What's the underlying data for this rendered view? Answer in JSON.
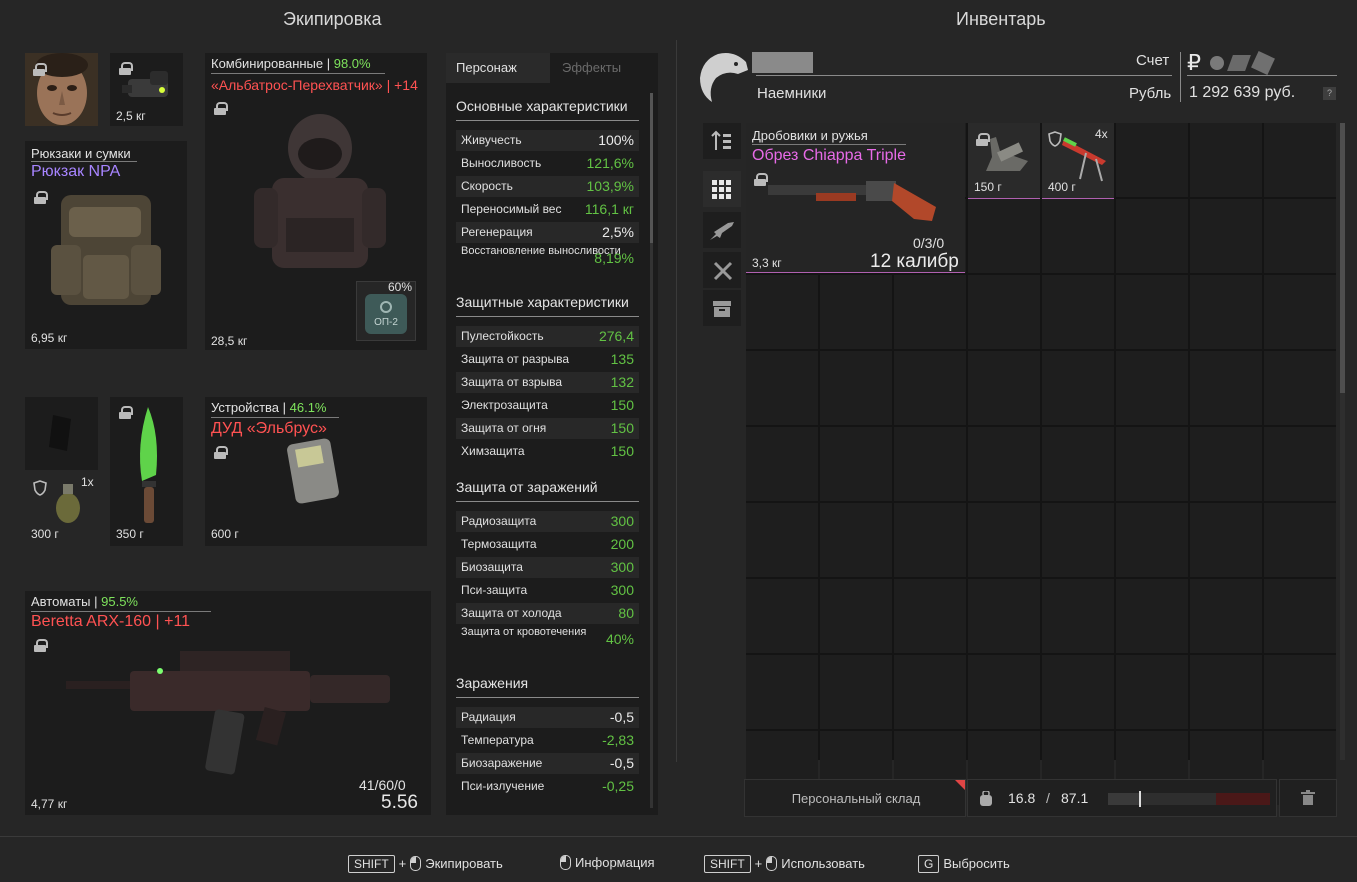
{
  "titles": {
    "equipment": "Экипировка",
    "inventory": "Инвентарь"
  },
  "colors": {
    "green": "#62c244",
    "pct_green": "#7ee35c",
    "red_item": "#ff5252",
    "purple_item": "#a784ff",
    "pink_item": "#e86be8"
  },
  "equip": {
    "head_icons": [
      "face-portrait",
      "night-vision-device"
    ],
    "nvd_weight": "2,5 кг",
    "backpack": {
      "category": "Рюкзаки и сумки",
      "name": "Рюкзак NPA",
      "weight": "6,95 кг"
    },
    "armor": {
      "category": "Комбинированные",
      "sep": " | ",
      "percent": "98.0%",
      "name": "«Альбатрос-Перехватчик» | +14",
      "weight": "28,5 кг",
      "container_percent": "60%",
      "container_label": "ОП-2"
    },
    "small1": {
      "weight": "300 г",
      "count": "1x"
    },
    "knife": {
      "weight": "350 г"
    },
    "device": {
      "category": "Устройства",
      "sep": " | ",
      "percent": "46.1%",
      "name": "ДУД «Эльбрус»",
      "weight": "600 г"
    },
    "rifle": {
      "category": "Автоматы",
      "sep": " | ",
      "percent": "95.5%",
      "name": "Beretta ARX-160 | +11",
      "weight": "4,77 кг",
      "ammo": "41/60/0",
      "caliber": "5.56"
    }
  },
  "stats": {
    "tabs": [
      "Персонаж",
      "Эффекты"
    ],
    "sections": [
      {
        "title": "Основные характеристики",
        "rows": [
          {
            "k": "Живучесть",
            "v": "100%",
            "c": "w"
          },
          {
            "k": "Выносливость",
            "v": "121,6%",
            "c": "g"
          },
          {
            "k": "Скорость",
            "v": "103,9%",
            "c": "g"
          },
          {
            "k": "Переносимый вес",
            "v": "116,1 кг",
            "c": "g"
          },
          {
            "k": "Регенерация",
            "v": "2,5%",
            "c": "w"
          },
          {
            "k": "Восстановление выносливости",
            "v": "8,19%",
            "c": "g"
          }
        ]
      },
      {
        "title": "Защитные характеристики",
        "rows": [
          {
            "k": "Пулестойкость",
            "v": "276,4",
            "c": "g"
          },
          {
            "k": "Защита от разрыва",
            "v": "135",
            "c": "g"
          },
          {
            "k": "Защита от взрыва",
            "v": "132",
            "c": "g"
          },
          {
            "k": "Электрозащита",
            "v": "150",
            "c": "g"
          },
          {
            "k": "Защита от огня",
            "v": "150",
            "c": "g"
          },
          {
            "k": "Химзащита",
            "v": "150",
            "c": "g"
          }
        ]
      },
      {
        "title": "Защита от заражений",
        "rows": [
          {
            "k": "Радиозащита",
            "v": "300",
            "c": "g"
          },
          {
            "k": "Термозащита",
            "v": "200",
            "c": "g"
          },
          {
            "k": "Биозащита",
            "v": "300",
            "c": "g"
          },
          {
            "k": "Пси-защита",
            "v": "300",
            "c": "g"
          },
          {
            "k": "Защита от холода",
            "v": "80",
            "c": "g"
          },
          {
            "k": "Защита от кровотечения",
            "v": "40%",
            "c": "g"
          }
        ]
      },
      {
        "title": "Заражения",
        "rows": [
          {
            "k": "Радиация",
            "v": "-0,5",
            "c": "w"
          },
          {
            "k": "Температура",
            "v": "-2,83",
            "c": "g"
          },
          {
            "k": "Биозаражение",
            "v": "-0,5",
            "c": "w"
          },
          {
            "k": "Пси-излучение",
            "v": "-0,25",
            "c": "g"
          }
        ]
      }
    ]
  },
  "inventory": {
    "faction": "Наемники",
    "account_label": "Счет",
    "currency_label": "Рубль",
    "money": "1 292 639 руб.",
    "help": "?",
    "shotgun": {
      "category": "Дробовики и ружья",
      "name": "Обрез Chiappa Triple",
      "weight": "3,3 кг",
      "ammo": "0/3/0",
      "caliber": "12 калибр"
    },
    "item2": {
      "weight": "150 г"
    },
    "item3": {
      "weight": "400 г",
      "count": "4x"
    },
    "storage": "Персональный склад",
    "weight_current": "16.8",
    "weight_sep": "/",
    "weight_max": "87.1",
    "weight_fraction": 0.193
  },
  "hints": [
    {
      "key": "SHIFT",
      "plus": "+",
      "label": "Экипировать"
    },
    {
      "label": "Информация"
    },
    {
      "key": "SHIFT",
      "plus": "+",
      "label": "Использовать"
    },
    {
      "key": "G",
      "label": "Выбросить"
    }
  ]
}
